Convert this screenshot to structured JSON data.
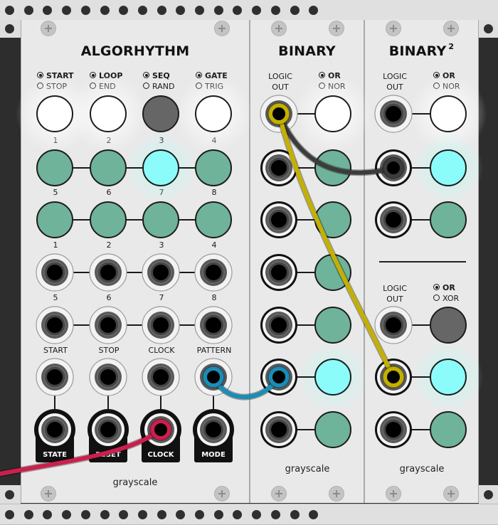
{
  "rack": {
    "rail_color": "#e0e0e0",
    "hole_color": "#2f2f2f",
    "background_color": "#2d2d2d"
  },
  "modules": {
    "algorhythm": {
      "title": "ALGORHYTHM",
      "brand": "grayscale",
      "toggles": [
        {
          "option_on": "START",
          "option_off": "STOP",
          "state": "on"
        },
        {
          "option_on": "LOOP",
          "option_off": "END",
          "state": "on"
        },
        {
          "option_on": "SEQ",
          "option_off": "RAND",
          "state": "off"
        },
        {
          "option_on": "GATE",
          "option_off": "TRIG",
          "state": "on"
        }
      ],
      "step_leds_row1": {
        "labels": [
          "1",
          "2",
          "3",
          "4"
        ],
        "states": [
          "off",
          "off",
          "active",
          "off"
        ]
      },
      "step_leds_row2": {
        "labels": [
          "5",
          "6",
          "7",
          "8"
        ],
        "states": [
          "off",
          "off",
          "off",
          "off"
        ]
      },
      "step_inputs_row1": {
        "labels": [
          "1",
          "2",
          "3",
          "4"
        ]
      },
      "step_inputs_row2": {
        "labels": [
          "5",
          "6",
          "7",
          "8"
        ]
      },
      "control_inputs": {
        "labels": [
          "START",
          "STOP",
          "CLOCK",
          "PATTERN"
        ]
      },
      "outputs": {
        "labels": [
          "STATE",
          "RESET",
          "CLOCK",
          "MODE"
        ]
      }
    },
    "binary": {
      "title": "BINARY",
      "brand": "grayscale",
      "logic_label_line1": "LOGIC",
      "logic_label_line2": "OUT",
      "mode_on": "OR",
      "mode_off": "NOR",
      "logic_led_state": "white",
      "channel_led_states": [
        "off",
        "off",
        "off",
        "off",
        "active",
        "off"
      ]
    },
    "binary2": {
      "title": "BINARY",
      "title_superscript": "2",
      "brand": "grayscale",
      "section1": {
        "logic_label_line1": "LOGIC",
        "logic_label_line2": "OUT",
        "mode_on": "OR",
        "mode_off": "NOR",
        "logic_led_state": "white",
        "channel_led_states": [
          "active",
          "off"
        ]
      },
      "section2": {
        "logic_label_line1": "LOGIC",
        "logic_label_line2": "OUT",
        "mode_on": "OR",
        "mode_off": "XOR",
        "logic_led_state": "dark",
        "channel_led_states": [
          "active",
          "off"
        ]
      }
    }
  },
  "colors": {
    "led_white": "#ffffff",
    "led_dark": "#666666",
    "led_off": "#6fb39b",
    "led_active": "#8cfcfb",
    "cable_yellow": "#c4b000",
    "cable_dark": "#3c3c3c",
    "cable_blue": "#1a8db7",
    "cable_red": "#cc1f4e"
  },
  "cables": [
    {
      "color": "cable_yellow",
      "from": "binary.logic_out",
      "to": "binary2.section2.input_1"
    },
    {
      "color": "cable_dark",
      "from": "binary.logic_out",
      "to": "binary2.section1.input_1"
    },
    {
      "color": "cable_blue",
      "from": "algorhythm.pattern_input",
      "to": "binary.input_5"
    },
    {
      "color": "cable_red",
      "from": "off-screen-left",
      "to": "algorhythm.clock_output"
    }
  ]
}
